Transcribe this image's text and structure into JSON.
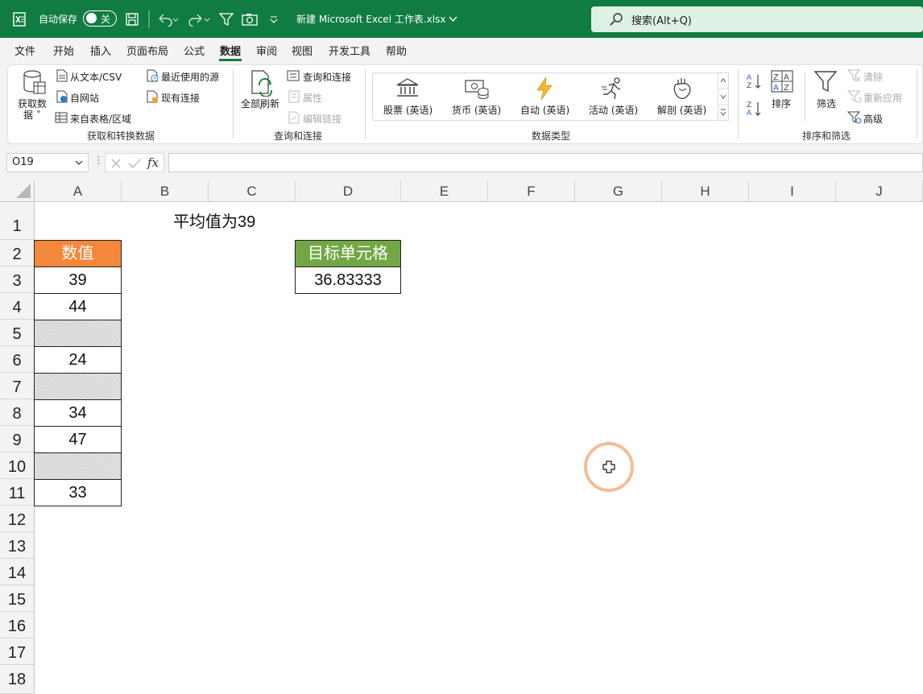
{
  "titlebar": {
    "autosave_label": "自动保存",
    "autosave_state": "关",
    "file_title": "新建 Microsoft Excel 工作表.xlsx",
    "search_text": "搜索(Alt+Q)"
  },
  "menu": {
    "items": [
      "文件",
      "开始",
      "插入",
      "页面布局",
      "公式",
      "数据",
      "审阅",
      "视图",
      "开发工具",
      "帮助"
    ],
    "active": "数据"
  },
  "ribbon": {
    "get_data": "获取数",
    "get_data2": "据",
    "from_text": "从文本/CSV",
    "from_web": "自网站",
    "from_table": "来自表格/区域",
    "recent_sources": "最近使用的源",
    "existing_conn": "现有连接",
    "group_get": "获取和转换数据",
    "refresh_all": "全部刷新",
    "queries_conn": "查询和连接",
    "properties": "属性",
    "edit_links": "编辑链接",
    "group_query": "查询和连接",
    "dtype_stocks": "股票 (英语)",
    "dtype_currency": "货币 (英语)",
    "dtype_auto": "自动 (英语)",
    "dtype_activity": "活动 (英语)",
    "dtype_anatomy": "解剖 (英语)",
    "group_dtype": "数据类型",
    "sort": "排序",
    "filter": "筛选",
    "clear": "清除",
    "reapply": "重新应用",
    "advanced": "高级",
    "group_sort": "排序和筛选"
  },
  "formula_bar": {
    "name_box": "O19",
    "formula": ""
  },
  "columns": [
    "A",
    "B",
    "C",
    "D",
    "E",
    "F",
    "G",
    "H",
    "I",
    "J"
  ],
  "rows": [
    "1",
    "2",
    "3",
    "4",
    "5",
    "6",
    "7",
    "8",
    "9",
    "10",
    "11",
    "12",
    "13",
    "14",
    "15",
    "16",
    "17",
    "18"
  ],
  "sheet": {
    "note": "平均值为39",
    "header_a": "数值",
    "values_a": [
      "39",
      "44",
      "",
      "24",
      "",
      "34",
      "47",
      "",
      "33"
    ],
    "header_d": "目标单元格",
    "value_d": "36.83333"
  },
  "colors": {
    "brand": "#107c41",
    "orange_header": "#f4883a",
    "green_header": "#72a745"
  }
}
